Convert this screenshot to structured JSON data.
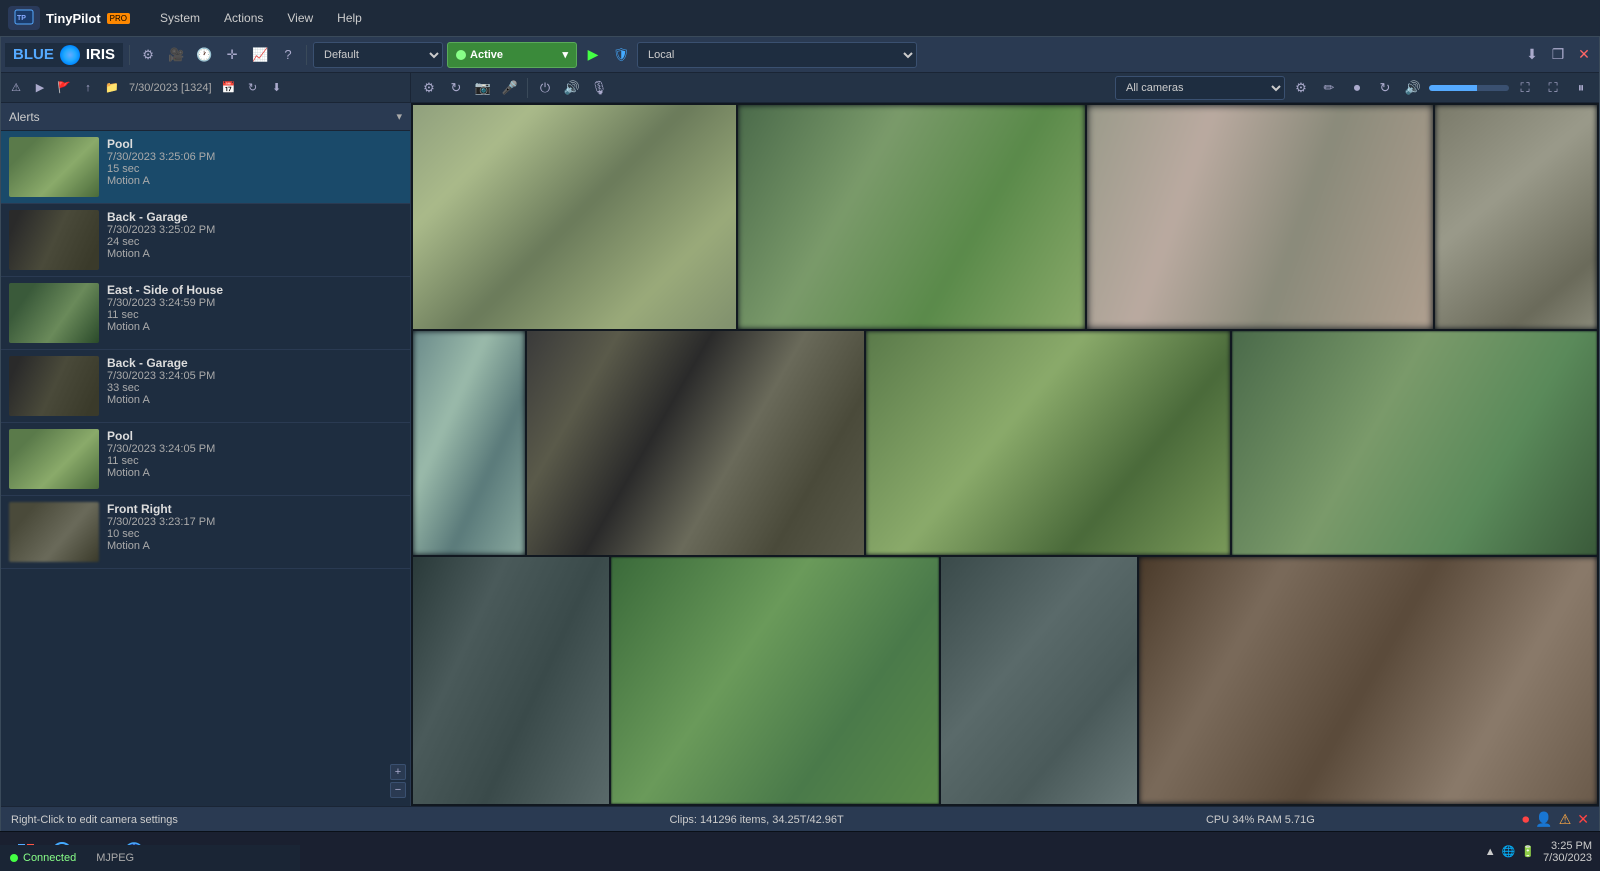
{
  "titlebar": {
    "app_name": "TinyPilot",
    "pro_label": "PRO",
    "menus": [
      "System",
      "Actions",
      "View",
      "Help"
    ]
  },
  "toolbar": {
    "profile": "Default",
    "status": "Active",
    "location": "Local",
    "window_controls": [
      "minimize",
      "restore",
      "close"
    ]
  },
  "left_toolbar": {
    "date_label": "7/30/2023 [1324]"
  },
  "alerts": {
    "header": "Alerts",
    "items": [
      {
        "name": "Pool",
        "date": "7/30/2023 3:25:06 PM",
        "duration": "15 sec",
        "type": "Motion A",
        "thumb_class": "thumb-pool"
      },
      {
        "name": "Back - Garage",
        "date": "7/30/2023 3:25:02 PM",
        "duration": "24 sec",
        "type": "Motion A",
        "thumb_class": "thumb-garage"
      },
      {
        "name": "East - Side of House",
        "date": "7/30/2023 3:24:59 PM",
        "duration": "11 sec",
        "type": "Motion A",
        "thumb_class": "thumb-east"
      },
      {
        "name": "Back - Garage",
        "date": "7/30/2023 3:24:05 PM",
        "duration": "33 sec",
        "type": "Motion A",
        "thumb_class": "thumb-garage"
      },
      {
        "name": "Pool",
        "date": "7/30/2023 3:24:05 PM",
        "duration": "11 sec",
        "type": "Motion A",
        "thumb_class": "thumb-pool"
      },
      {
        "name": "Front Right",
        "date": "7/30/2023 3:23:17 PM",
        "duration": "10 sec",
        "type": "Motion A",
        "thumb_class": "thumb-frontright"
      }
    ]
  },
  "cameras": {
    "filter": "All cameras",
    "feeds": [
      {
        "id": 1,
        "label": "",
        "feed_class": "feed-pool"
      },
      {
        "id": 2,
        "label": "",
        "feed_class": "feed-backyard"
      },
      {
        "id": 3,
        "label": "",
        "feed_class": "feed-side"
      },
      {
        "id": 4,
        "label": "",
        "feed_class": "feed-front"
      },
      {
        "id": 5,
        "label": "",
        "feed_class": "feed-garage"
      },
      {
        "id": 6,
        "label": "",
        "feed_class": "feed-driveway"
      },
      {
        "id": 7,
        "label": "",
        "feed_class": "feed-backfence"
      },
      {
        "id": 8,
        "label": "",
        "feed_class": "feed-side2"
      },
      {
        "id": 9,
        "label": "",
        "feed_class": "feed-hvac"
      },
      {
        "id": 10,
        "label": "",
        "feed_class": "feed-shed"
      },
      {
        "id": 11,
        "label": "",
        "feed_class": "feed-equip"
      },
      {
        "id": 12,
        "label": "",
        "feed_class": "feed-garage2"
      }
    ]
  },
  "statusbar": {
    "tip": "Right-Click to edit camera settings",
    "clips": "Clips: 141296 items, 34.25T/42.96T",
    "system": "CPU 34% RAM 5.71G"
  },
  "taskbar": {
    "time": "3:25 PM",
    "date": "7/30/2023",
    "codec": "MJPEG",
    "connected": "Connected"
  }
}
